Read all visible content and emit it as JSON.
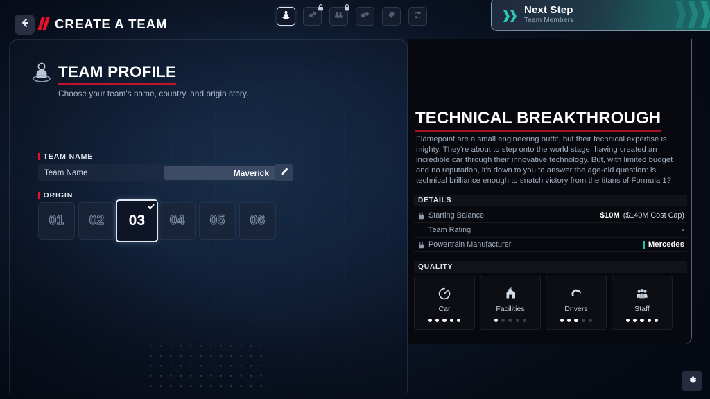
{
  "header": {
    "back_icon": "arrow-left-icon",
    "title": "CREATE A TEAM",
    "steps": [
      {
        "name": "team-profile",
        "icon": "person-icon",
        "active": true,
        "locked": false
      },
      {
        "name": "car-development",
        "icon": "gear-car-icon",
        "active": false,
        "locked": true
      },
      {
        "name": "team-members",
        "icon": "people-icon",
        "active": false,
        "locked": true
      },
      {
        "name": "sponsors",
        "icon": "car-flag-icon",
        "active": false,
        "locked": false
      },
      {
        "name": "branding",
        "icon": "tag-icon",
        "active": false,
        "locked": false
      },
      {
        "name": "settings",
        "icon": "sliders-icon",
        "active": false,
        "locked": false
      }
    ],
    "next_step": {
      "title": "Next Step",
      "subtitle": "Team Members",
      "icon": "double-chevron-right-icon",
      "accent": "#2ec4b1"
    }
  },
  "profile": {
    "icon": "team-profile-icon",
    "heading": "TEAM PROFILE",
    "subheading": "Choose your team's name, country, and origin story.",
    "accent": "#c4122c",
    "team_name": {
      "section_label": "TEAM NAME",
      "field_label": "Team Name",
      "value": "Maverick",
      "placeholder": "Team Name",
      "edit_icon": "pencil-icon"
    },
    "origin": {
      "section_label": "ORIGIN",
      "selected_index": 2,
      "check_icon": "check-icon",
      "cards": [
        "01",
        "02",
        "03",
        "04",
        "05",
        "06"
      ]
    }
  },
  "info": {
    "title": "TECHNICAL BREAKTHROUGH",
    "accent": "#a51024",
    "description": "Flamepoint are a small engineering outfit, but their technical expertise is mighty. They're about to step onto the world stage, having created an incredible car through their innovative technology. But, with limited budget and no reputation, it's down to you to answer the age-old question: is technical brilliance enough to snatch victory from the titans of Formula 1?",
    "details_heading": "DETAILS",
    "details": [
      {
        "label": "Starting Balance",
        "value_strong": "$10M",
        "value_rest": "($140M Cost Cap)",
        "locked": true,
        "lock_icon": "lock-icon",
        "bar": false
      },
      {
        "label": "Team Rating",
        "value_strong": "",
        "value_rest": "-",
        "locked": false,
        "lock_icon": "",
        "bar": false
      },
      {
        "label": "Powertrain Manufacturer",
        "value_strong": "Mercedes",
        "value_rest": "",
        "locked": true,
        "lock_icon": "lock-icon",
        "bar": true,
        "bar_color": "#17c8a5"
      }
    ],
    "quality_heading": "QUALITY",
    "quality": [
      {
        "label": "Car",
        "icon": "speedometer-icon",
        "filled": 5,
        "total": 5
      },
      {
        "label": "Facilities",
        "icon": "factory-icon",
        "filled": 1,
        "total": 5
      },
      {
        "label": "Drivers",
        "icon": "helmet-icon",
        "filled": 3,
        "total": 5
      },
      {
        "label": "Staff",
        "icon": "people-group-icon",
        "filled": 5,
        "total": 5
      }
    ]
  },
  "footer": {
    "settings_icon": "gear-icon"
  }
}
